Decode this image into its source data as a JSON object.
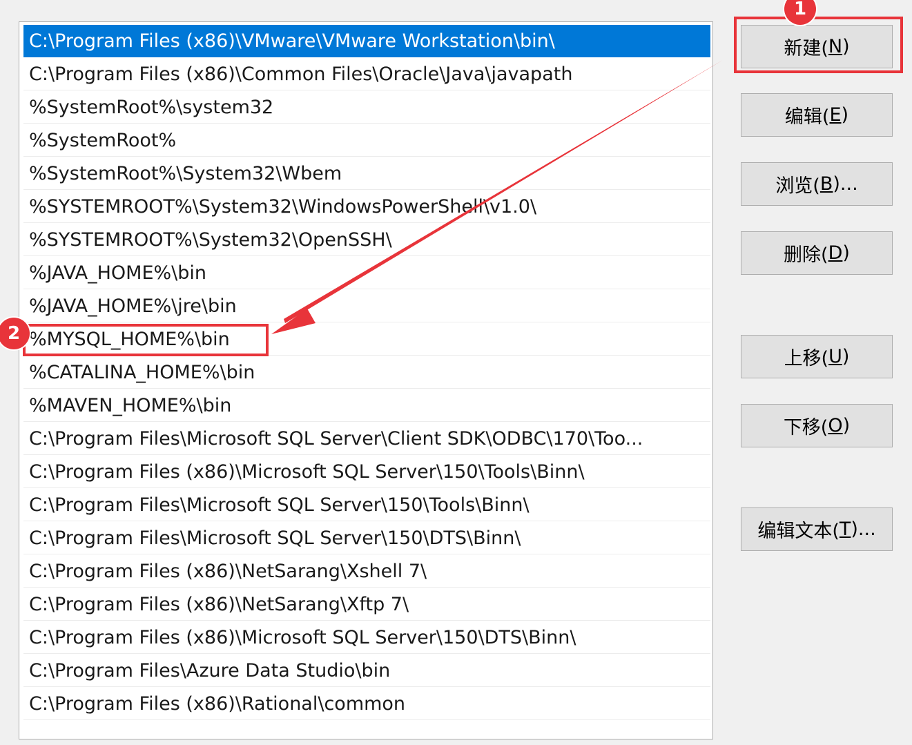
{
  "path_list": {
    "selected_index": 0,
    "items": [
      "C:\\Program Files (x86)\\VMware\\VMware Workstation\\bin\\",
      "C:\\Program Files (x86)\\Common Files\\Oracle\\Java\\javapath",
      "%SystemRoot%\\system32",
      "%SystemRoot%",
      "%SystemRoot%\\System32\\Wbem",
      "%SYSTEMROOT%\\System32\\WindowsPowerShell\\v1.0\\",
      "%SYSTEMROOT%\\System32\\OpenSSH\\",
      "%JAVA_HOME%\\bin",
      "%JAVA_HOME%\\jre\\bin",
      "%MYSQL_HOME%\\bin",
      "%CATALINA_HOME%\\bin",
      "%MAVEN_HOME%\\bin",
      "C:\\Program Files\\Microsoft SQL Server\\Client SDK\\ODBC\\170\\Too...",
      "C:\\Program Files (x86)\\Microsoft SQL Server\\150\\Tools\\Binn\\",
      "C:\\Program Files\\Microsoft SQL Server\\150\\Tools\\Binn\\",
      "C:\\Program Files\\Microsoft SQL Server\\150\\DTS\\Binn\\",
      "C:\\Program Files (x86)\\NetSarang\\Xshell 7\\",
      "C:\\Program Files (x86)\\NetSarang\\Xftp 7\\",
      "C:\\Program Files (x86)\\Microsoft SQL Server\\150\\DTS\\Binn\\",
      "C:\\Program Files\\Azure Data Studio\\bin",
      "C:\\Program Files (x86)\\Rational\\common"
    ]
  },
  "buttons": {
    "new": {
      "label": "新建(",
      "accel": "N",
      "suffix": ")"
    },
    "edit": {
      "label": "编辑(",
      "accel": "E",
      "suffix": ")"
    },
    "browse": {
      "label": "浏览(",
      "accel": "B",
      "suffix": ")..."
    },
    "delete": {
      "label": "删除(",
      "accel": "D",
      "suffix": ")"
    },
    "move_up": {
      "label": "上移(",
      "accel": "U",
      "suffix": ")"
    },
    "move_down": {
      "label": "下移(",
      "accel": "O",
      "suffix": ")"
    },
    "edit_text": {
      "label": "编辑文本(",
      "accel": "T",
      "suffix": ")..."
    }
  },
  "annotations": {
    "badge_1": "1",
    "badge_2": "2",
    "color": "#e8343a"
  },
  "colors": {
    "selection": "#0078d7",
    "window_bg": "#f0f0f0",
    "button_bg": "#e1e1e1"
  }
}
